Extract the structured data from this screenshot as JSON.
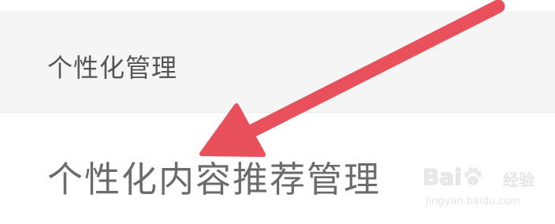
{
  "section_header": {
    "label": "个性化管理"
  },
  "list_item": {
    "label": "个性化内容推荐管理"
  },
  "annotation": {
    "arrow_color": "#e8505b"
  },
  "watermark": {
    "brand_bai": "Bai",
    "brand_du": "du",
    "brand_jingyan": "经验",
    "url": "jingyan.baidu.com"
  },
  "colors": {
    "header_background": "#f5f5f5",
    "item_background": "#ffffff",
    "header_text": "#555555",
    "item_text": "#6b6b6b"
  }
}
